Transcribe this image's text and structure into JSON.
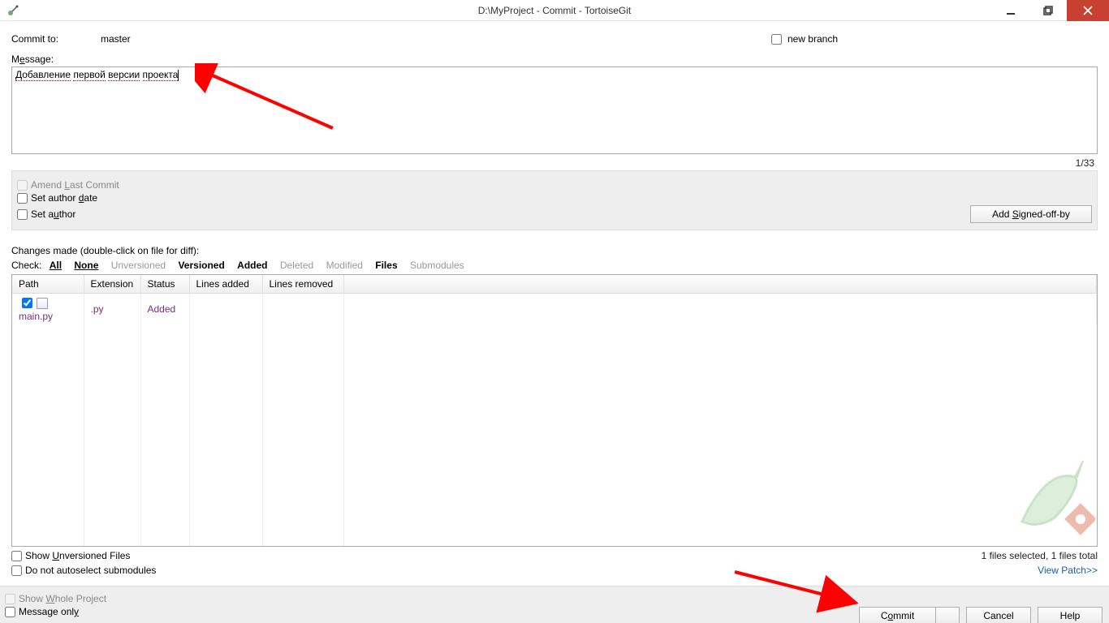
{
  "window": {
    "title": "D:\\MyProject - Commit - TortoiseGit"
  },
  "commit": {
    "to_label": "Commit to:",
    "branch": "master",
    "new_branch_label": "new branch"
  },
  "message": {
    "label_pre": "M",
    "label_ul": "e",
    "label_post": "ssage:",
    "text_words": [
      "Добавление",
      "первой",
      "версии",
      "проекта"
    ],
    "count": "1/33"
  },
  "options": {
    "amend": "Amend Last Commit",
    "amend_ul": "L",
    "set_author_date": "Set author date",
    "set_author_date_ul": "d",
    "set_author": "Set author",
    "set_author_ul": "u",
    "signed_off": "Add Signed-off-by",
    "signed_off_ul": "S"
  },
  "changes": {
    "label": "Changes made (double-click on file for diff):",
    "check_label": "Check:",
    "filters": {
      "all": "All",
      "none": "None",
      "unversioned": "Unversioned",
      "versioned": "Versioned",
      "added": "Added",
      "deleted": "Deleted",
      "modified": "Modified",
      "files": "Files",
      "submodules": "Submodules"
    },
    "headers": {
      "path": "Path",
      "ext": "Extension",
      "status": "Status",
      "added": "Lines added",
      "removed": "Lines removed"
    },
    "rows": [
      {
        "checked": true,
        "name": "main.py",
        "ext": ".py",
        "status": "Added",
        "added": "",
        "removed": ""
      }
    ]
  },
  "summary": {
    "files": "1 files selected, 1 files total",
    "view_patch": "View Patch>>"
  },
  "bottom": {
    "show_unversioned": "Show Unversioned Files",
    "show_unversioned_ul": "U",
    "no_autoselect": "Do not autoselect submodules",
    "show_whole": "Show Whole Project",
    "show_whole_ul": "W",
    "message_only": "Message only",
    "message_only_ul": "y"
  },
  "buttons": {
    "commit": "Commit",
    "commit_ul": "o",
    "cancel": "Cancel",
    "help": "Help"
  }
}
